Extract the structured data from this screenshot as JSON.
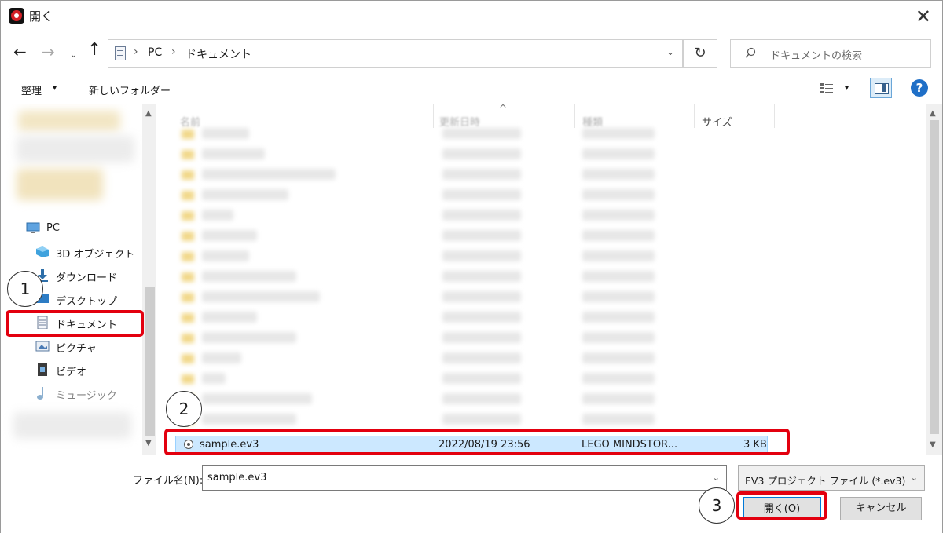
{
  "window": {
    "title": "開く",
    "close_glyph": "✕"
  },
  "nav": {
    "back_glyph": "←",
    "forward_glyph": "→",
    "recent_glyph": "⌄",
    "up_glyph": "↑",
    "breadcrumb": [
      "PC",
      "ドキュメント"
    ],
    "breadcrumb_sep": "›",
    "dropdown_glyph": "⌄",
    "refresh_glyph": "↻",
    "search_placeholder": "ドキュメントの検索"
  },
  "toolbar": {
    "organize_label": "整理",
    "organize_arrow": "▾",
    "new_folder_label": "新しいフォルダー",
    "view_arrow": "▾",
    "help_label": "?"
  },
  "nav_pane": {
    "scroll_up": "▲",
    "scroll_down": "▼",
    "items": [
      {
        "label": "PC",
        "icon": "pc-icon"
      },
      {
        "label": "3D オブジェクト",
        "icon": "3d-objects-icon"
      },
      {
        "label": "ダウンロード",
        "icon": "download-icon"
      },
      {
        "label": "デスクトップ",
        "icon": "desktop-icon"
      },
      {
        "label": "ドキュメント",
        "icon": "documents-icon"
      },
      {
        "label": "ピクチャ",
        "icon": "pictures-icon"
      },
      {
        "label": "ビデオ",
        "icon": "videos-icon"
      },
      {
        "label": "ミュージック",
        "icon": "music-icon"
      }
    ]
  },
  "file_list": {
    "columns": [
      "名前",
      "更新日時",
      "種類",
      "サイズ"
    ],
    "sort_caret": "^",
    "scroll_up": "▲",
    "scroll_down": "▼",
    "selected_file": {
      "name": "sample.ev3",
      "modified": "2022/08/19 23:56",
      "type": "LEGO MINDSTOR...",
      "size": "3 KB"
    }
  },
  "bottom": {
    "filename_label": "ファイル名(N):",
    "filename_value": "sample.ev3",
    "dropdown_glyph": "⌄",
    "filetype_value": "EV3 プロジェクト ファイル (*.ev3)",
    "open_button": "開く(O)",
    "cancel_button": "キャンセル"
  },
  "annotations": {
    "step1": "1",
    "step2": "2",
    "step3": "3",
    "highlight_color": "#e3000f"
  }
}
